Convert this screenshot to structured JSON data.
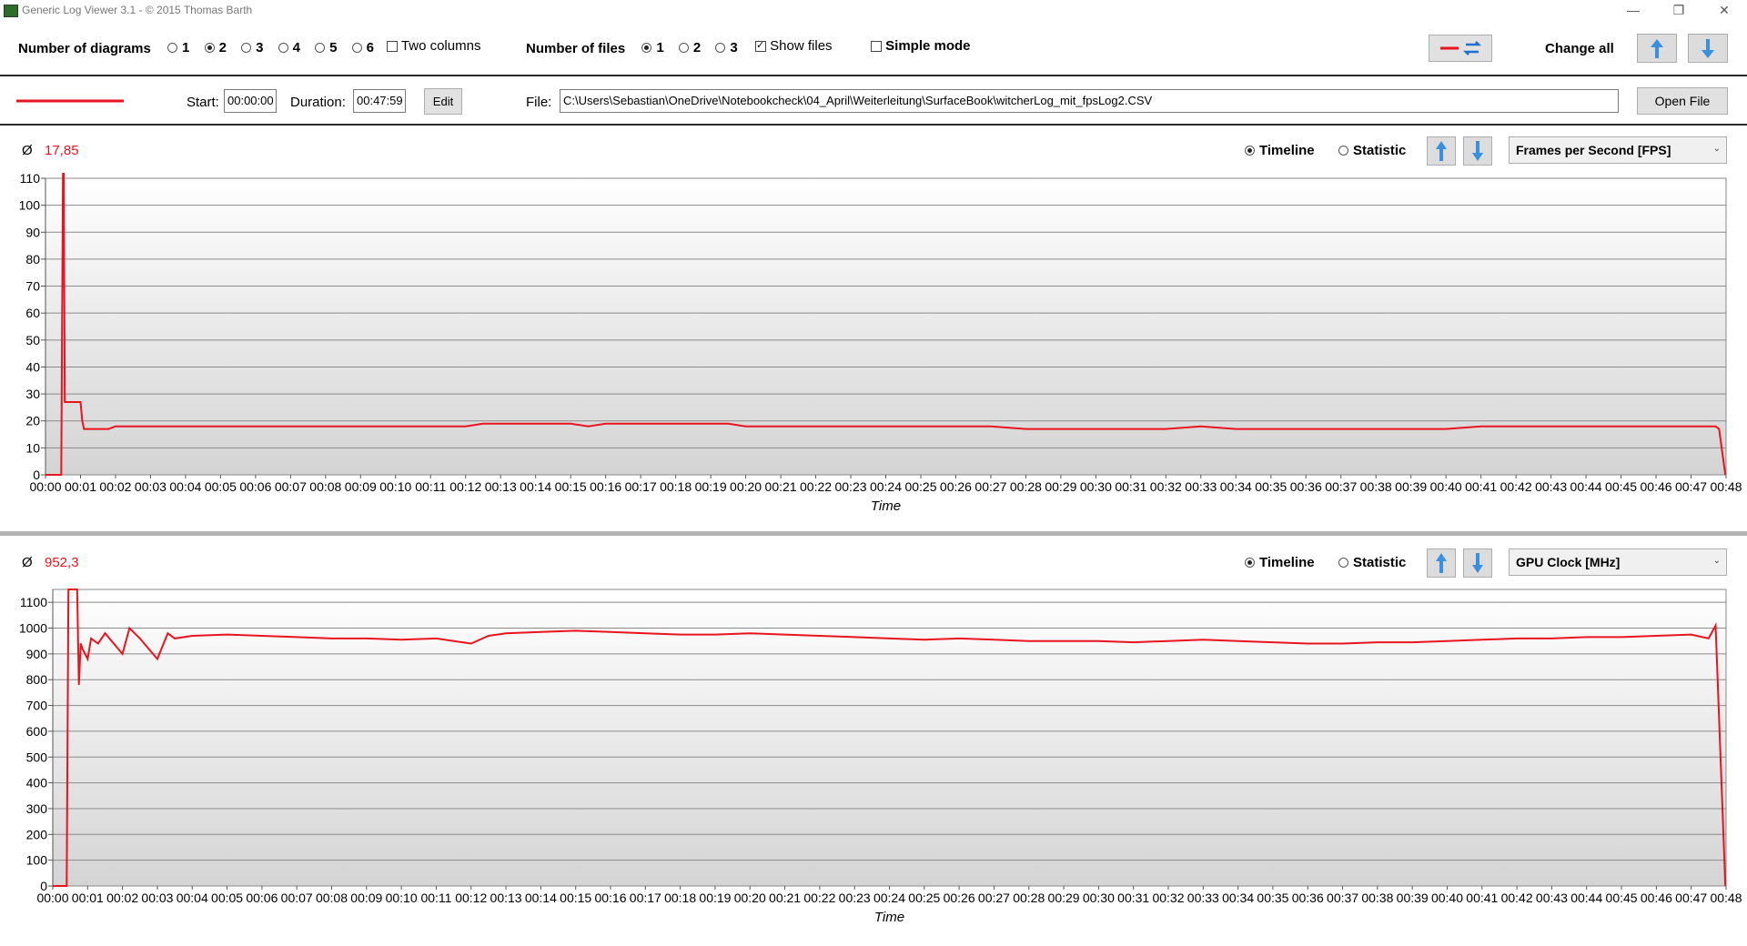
{
  "window": {
    "title": "Generic Log Viewer 3.1 - © 2015 Thomas Barth",
    "controls": [
      "—",
      "❐",
      "✕"
    ]
  },
  "toolbar": {
    "num_diagrams_label": "Number of diagrams",
    "diagram_options": [
      "1",
      "2",
      "3",
      "4",
      "5",
      "6"
    ],
    "diagram_selected": "2",
    "two_columns_label": "Two columns",
    "two_columns_checked": false,
    "num_files_label": "Number of files",
    "file_options": [
      "1",
      "2",
      "3"
    ],
    "file_selected": "1",
    "show_files_label": "Show files",
    "show_files_checked": true,
    "simple_mode_label": "Simple mode",
    "simple_mode_checked": false,
    "change_all_label": "Change all"
  },
  "file_row": {
    "line_color": "#e8141e",
    "start_label": "Start:",
    "start_value": "00:00:00",
    "duration_label": "Duration:",
    "duration_value": "00:47:59",
    "edit_label": "Edit",
    "file_label": "File:",
    "file_path": "C:\\Users\\Sebastian\\OneDrive\\Notebookcheck\\04_April\\Weiterleitung\\SurfaceBook\\witcherLog_mit_fpsLog2.CSV",
    "open_file_label": "Open File"
  },
  "charts": [
    {
      "avg_symbol": "Ø",
      "avg_value": "17,85",
      "timeline_label": "Timeline",
      "statistic_label": "Statistic",
      "mode": "Timeline",
      "metric": "Frames per Second [FPS]"
    },
    {
      "avg_symbol": "Ø",
      "avg_value": "952,3",
      "timeline_label": "Timeline",
      "statistic_label": "Statistic",
      "mode": "Timeline",
      "metric": "GPU Clock [MHz]"
    }
  ],
  "chart_data": [
    {
      "type": "line",
      "title": "",
      "xlabel": "Time",
      "ylabel": "",
      "ylim": [
        0,
        110
      ],
      "y_ticks": [
        0,
        10,
        20,
        30,
        40,
        50,
        60,
        70,
        80,
        90,
        100,
        110
      ],
      "x_tick_labels": [
        "00:00",
        "00:01",
        "00:02",
        "00:03",
        "00:04",
        "00:05",
        "00:06",
        "00:07",
        "00:08",
        "00:09",
        "00:10",
        "00:11",
        "00:12",
        "00:13",
        "00:14",
        "00:15",
        "00:16",
        "00:17",
        "00:18",
        "00:19",
        "00:20",
        "00:21",
        "00:22",
        "00:23",
        "00:24",
        "00:25",
        "00:26",
        "00:27",
        "00:28",
        "00:29",
        "00:30",
        "00:31",
        "00:32",
        "00:33",
        "00:34",
        "00:35",
        "00:36",
        "00:37",
        "00:38",
        "00:39",
        "00:40",
        "00:41",
        "00:42",
        "00:43",
        "00:44",
        "00:45",
        "00:46",
        "00:47",
        "00:48"
      ],
      "grid": true,
      "color": "#e8141e",
      "series": [
        {
          "x_minutes": [
            0,
            0.2,
            0.45,
            0.5,
            0.52,
            0.55,
            1.0,
            1.05,
            1.1,
            1.8,
            2.0,
            6.0,
            8.5,
            9.0,
            10.0,
            12.0,
            12.5,
            13.0,
            15.0,
            15.5,
            16.0,
            17.0,
            18.0,
            19.5,
            20.0,
            20.5,
            24.0,
            25.0,
            26.0,
            27.0,
            28.0,
            30.0,
            32.0,
            33.0,
            34.0,
            35.0,
            38.0,
            39.0,
            40.0,
            41.0,
            42.0,
            43.0,
            44.0,
            45.0,
            46.0,
            47.0,
            47.7,
            47.8,
            47.98
          ],
          "y": [
            0,
            0,
            0,
            112,
            112,
            27,
            27,
            20,
            17,
            17,
            18,
            18,
            18,
            18,
            18,
            18,
            19,
            19,
            19,
            18,
            19,
            19,
            19,
            19,
            18,
            18,
            18,
            18,
            18,
            18,
            17,
            17,
            17,
            18,
            17,
            17,
            17,
            17,
            17,
            18,
            18,
            18,
            18,
            18,
            18,
            18,
            18,
            17,
            0
          ]
        }
      ]
    },
    {
      "type": "line",
      "title": "",
      "xlabel": "Time",
      "ylabel": "",
      "ylim": [
        0,
        1150
      ],
      "y_ticks": [
        0,
        100,
        200,
        300,
        400,
        500,
        600,
        700,
        800,
        900,
        1000,
        1100
      ],
      "x_tick_labels": [
        "00:00",
        "00:01",
        "00:02",
        "00:03",
        "00:04",
        "00:05",
        "00:06",
        "00:07",
        "00:08",
        "00:09",
        "00:10",
        "00:11",
        "00:12",
        "00:13",
        "00:14",
        "00:15",
        "00:16",
        "00:17",
        "00:18",
        "00:19",
        "00:20",
        "00:21",
        "00:22",
        "00:23",
        "00:24",
        "00:25",
        "00:26",
        "00:27",
        "00:28",
        "00:29",
        "00:30",
        "00:31",
        "00:32",
        "00:33",
        "00:34",
        "00:35",
        "00:36",
        "00:37",
        "00:38",
        "00:39",
        "00:40",
        "00:41",
        "00:42",
        "00:43",
        "00:44",
        "00:45",
        "00:46",
        "00:47",
        "00:48"
      ],
      "grid": true,
      "color": "#e8141e",
      "series": [
        {
          "x_minutes": [
            0,
            0.4,
            0.45,
            0.5,
            0.7,
            0.75,
            0.8,
            0.85,
            1.0,
            1.1,
            1.3,
            1.5,
            2.0,
            2.2,
            2.5,
            3.0,
            3.3,
            3.5,
            4.0,
            5.0,
            6.0,
            7.0,
            8.0,
            9.0,
            10.0,
            11.0,
            12.0,
            12.5,
            13.0,
            14.0,
            15.0,
            16.0,
            17.0,
            18.0,
            19.0,
            20.0,
            21.0,
            22.0,
            23.0,
            24.0,
            25.0,
            26.0,
            27.0,
            28.0,
            29.0,
            30.0,
            31.0,
            32.0,
            33.0,
            34.0,
            35.0,
            36.0,
            37.0,
            38.0,
            39.0,
            40.0,
            41.0,
            42.0,
            43.0,
            44.0,
            45.0,
            46.0,
            47.0,
            47.5,
            47.7,
            47.98
          ],
          "y": [
            0,
            0,
            1150,
            1150,
            1150,
            780,
            940,
            920,
            880,
            960,
            940,
            980,
            900,
            1000,
            960,
            880,
            980,
            960,
            970,
            975,
            970,
            965,
            960,
            960,
            955,
            960,
            940,
            970,
            980,
            985,
            990,
            985,
            980,
            975,
            975,
            980,
            975,
            970,
            965,
            960,
            955,
            960,
            955,
            950,
            950,
            950,
            945,
            950,
            955,
            950,
            945,
            940,
            940,
            945,
            945,
            950,
            955,
            960,
            960,
            965,
            965,
            970,
            975,
            960,
            1010,
            0
          ]
        }
      ]
    }
  ]
}
